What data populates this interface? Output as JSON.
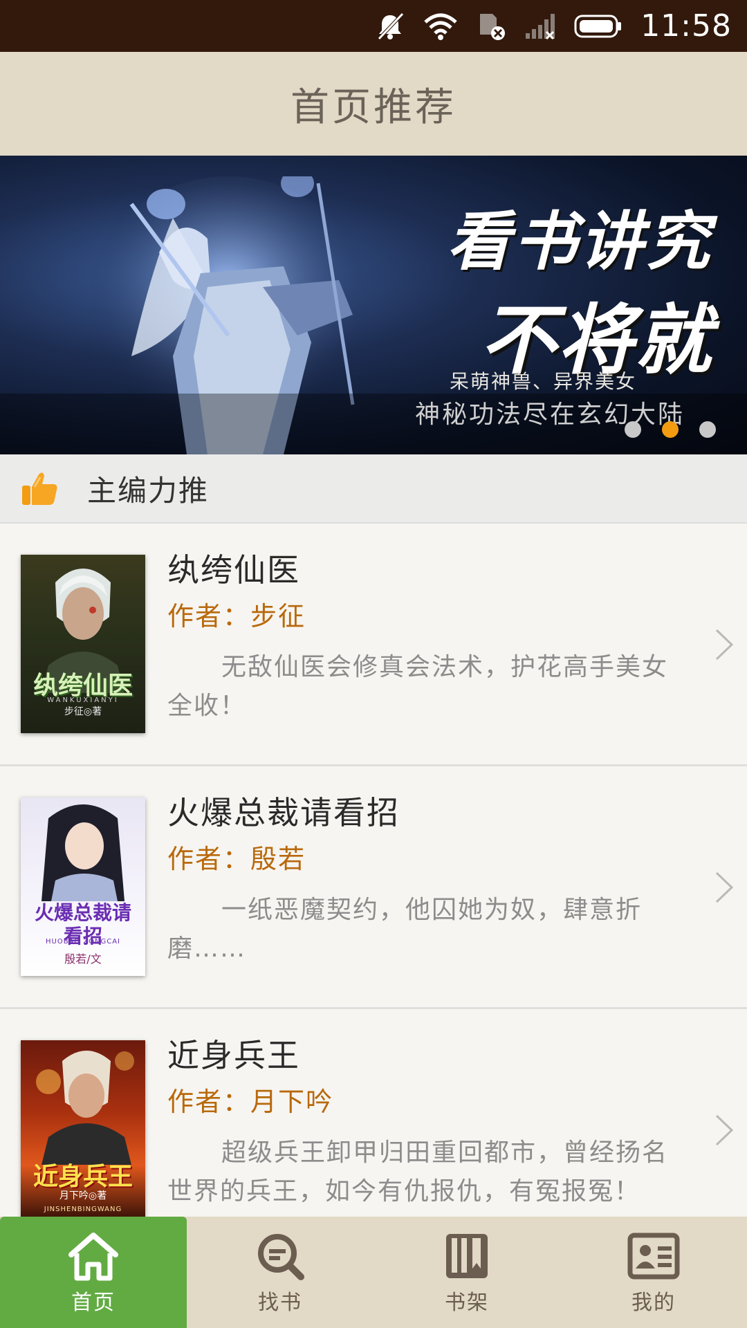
{
  "status_bar": {
    "time": "11:58",
    "icons": [
      "notifications-muted-icon",
      "wifi-icon",
      "sim-error-icon",
      "signal-icon",
      "battery-icon"
    ]
  },
  "header": {
    "title": "首页推荐"
  },
  "banner": {
    "headline_1": "看书讲究",
    "headline_2": "不将就",
    "subtitle_1": "呆萌神兽、异界美女",
    "subtitle_2": "神秘功法尽在玄幻大陆",
    "slide_count": 3,
    "active_slide": 2
  },
  "section": {
    "title": "主编力推",
    "icon": "thumbs-up-icon"
  },
  "books": [
    {
      "title": "纨绔仙医",
      "author": "作者：步征",
      "description": "无敌仙医会修真会法术，护花高手美女全收！",
      "cover": {
        "title": "纨绔仙医",
        "pinyin": "WANKUXIANYI",
        "author": "步征◎著"
      }
    },
    {
      "title": "火爆总裁请看招",
      "author": "作者：殷若",
      "description": "一纸恶魔契约，他囚她为奴，肆意折磨……",
      "cover": {
        "title": "火爆总裁请看招",
        "pinyin": "HUOBAO ZONGCAI",
        "author": "殷若/文"
      }
    },
    {
      "title": "近身兵王",
      "author": "作者：月下吟",
      "description": "超级兵王卸甲归田重回都市，曾经扬名世界的兵王，如今有仇报仇，有冤报冤！",
      "cover": {
        "title": "近身兵王",
        "pinyin": "JINSHENBINGWANG",
        "author": "月下吟◎著"
      }
    }
  ],
  "bottom_nav": {
    "items": [
      {
        "label": "首页",
        "icon": "home-icon",
        "active": true
      },
      {
        "label": "找书",
        "icon": "search-icon",
        "active": false
      },
      {
        "label": "书架",
        "icon": "bookshelf-icon",
        "active": false
      },
      {
        "label": "我的",
        "icon": "profile-card-icon",
        "active": false
      }
    ]
  },
  "colors": {
    "status_bar": "#32190c",
    "title_bar": "#e2d9c6",
    "author_text": "#b8690c",
    "active_tab": "#62ab43",
    "active_dot": "#f39c12"
  }
}
